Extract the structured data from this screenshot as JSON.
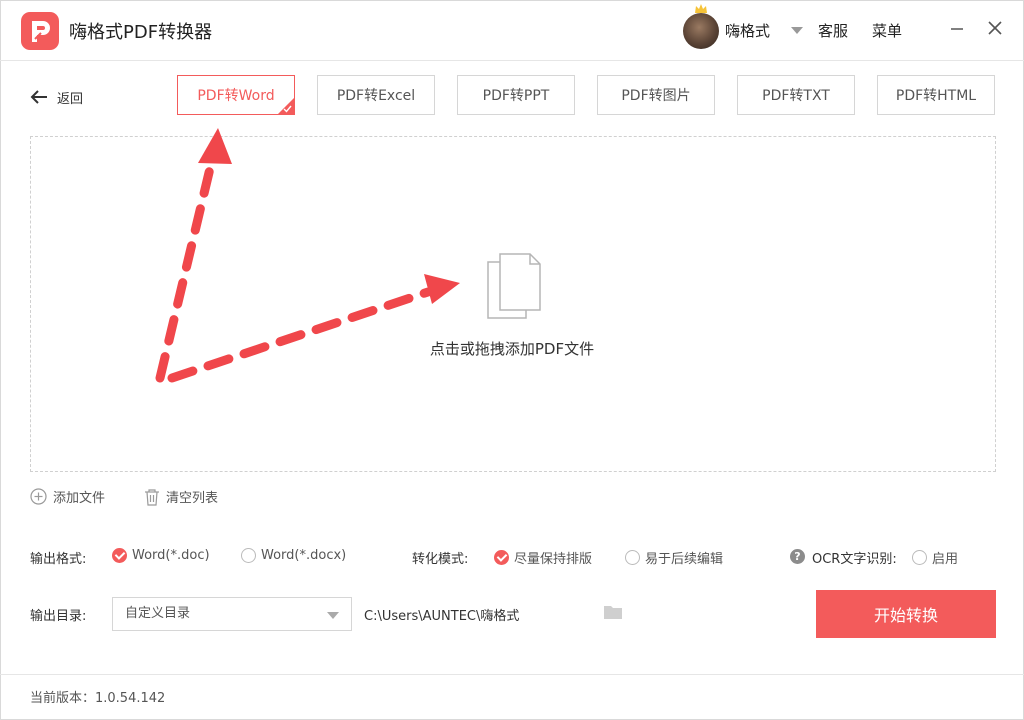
{
  "app": {
    "title": "嗨格式PDF转换器",
    "username": "嗨格式",
    "service_label": "客服",
    "menu_label": "菜单"
  },
  "nav": {
    "back_label": "返回"
  },
  "tabs": [
    {
      "label": "PDF转Word",
      "active": true
    },
    {
      "label": "PDF转Excel",
      "active": false
    },
    {
      "label": "PDF转PPT",
      "active": false
    },
    {
      "label": "PDF转图片",
      "active": false
    },
    {
      "label": "PDF转TXT",
      "active": false
    },
    {
      "label": "PDF转HTML",
      "active": false
    }
  ],
  "dropzone": {
    "hint": "点击或拖拽添加PDF文件"
  },
  "file_actions": {
    "add_label": "添加文件",
    "clear_label": "清空列表"
  },
  "options": {
    "output_format_label": "输出格式:",
    "formats": [
      {
        "label": "Word(*.doc)",
        "selected": true
      },
      {
        "label": "Word(*.docx)",
        "selected": false
      }
    ],
    "mode_label": "转化模式:",
    "modes": [
      {
        "label": "尽量保持排版",
        "selected": true
      },
      {
        "label": "易于后续编辑",
        "selected": false
      }
    ],
    "ocr_label": "OCR文字识别:",
    "ocr_option": {
      "label": "启用",
      "selected": false
    }
  },
  "output": {
    "dir_label": "输出目录:",
    "dir_select_value": "自定义目录",
    "dir_path": "C:\\Users\\AUNTEC\\嗨格式",
    "start_label": "开始转换"
  },
  "footer": {
    "version_text": "当前版本：1.0.54.142"
  },
  "colors": {
    "accent": "#f35b5b",
    "border": "#d6d6d6",
    "text": "#333333"
  }
}
